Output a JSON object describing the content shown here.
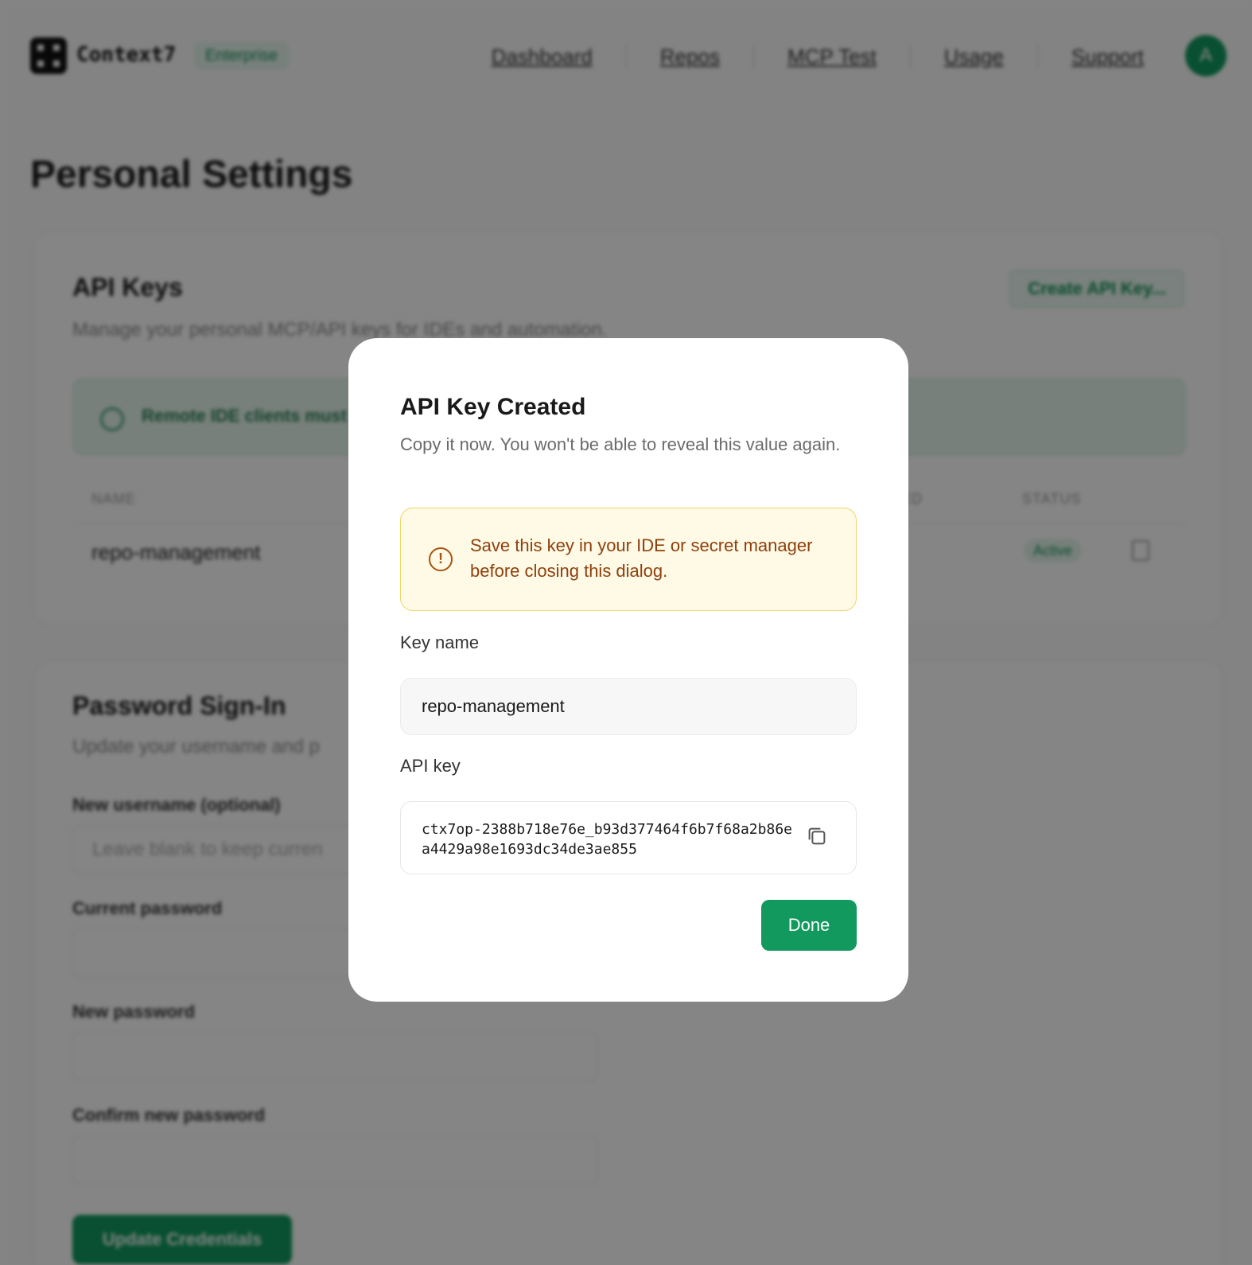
{
  "header": {
    "brand": "Context7",
    "edition_badge": "Enterprise",
    "nav": [
      "Dashboard",
      "Repos",
      "MCP Test",
      "Usage",
      "Support"
    ],
    "avatar_initial": "A"
  },
  "page_title": "Personal Settings",
  "api_keys_card": {
    "title": "API Keys",
    "subtitle": "Manage your personal MCP/API keys for IDEs and automation.",
    "create_button": "Create API Key...",
    "notice": "Remote IDE clients must",
    "columns": {
      "name": "NAME",
      "last_used_fragment": "ED",
      "status": "STATUS"
    },
    "rows": [
      {
        "name": "repo-management",
        "status": "Active"
      }
    ]
  },
  "password_card": {
    "title": "Password Sign-In",
    "subtitle": "Update your username and p",
    "new_username_label": "New username (optional)",
    "new_username_placeholder": "Leave blank to keep curren",
    "current_password_label": "Current password",
    "new_password_label": "New password",
    "confirm_password_label": "Confirm new password",
    "submit_button": "Update Credentials"
  },
  "modal": {
    "title": "API Key Created",
    "description": "Copy it now. You won't be able to reveal this value again.",
    "warning": "Save this key in your IDE or secret manager before closing this dialog.",
    "key_name_label": "Key name",
    "key_name_value": "repo-management",
    "api_key_label": "API key",
    "api_key_value": "ctx7op-2388b718e76e_b93d377464f6b7f68a2b86ea4429a98e1693dc34de3ae855",
    "done_button": "Done"
  },
  "colors": {
    "accent": "#11995e",
    "warning_bg": "#fefae6",
    "warning_border": "#f0d56b",
    "warning_text": "#8f3f0c"
  }
}
